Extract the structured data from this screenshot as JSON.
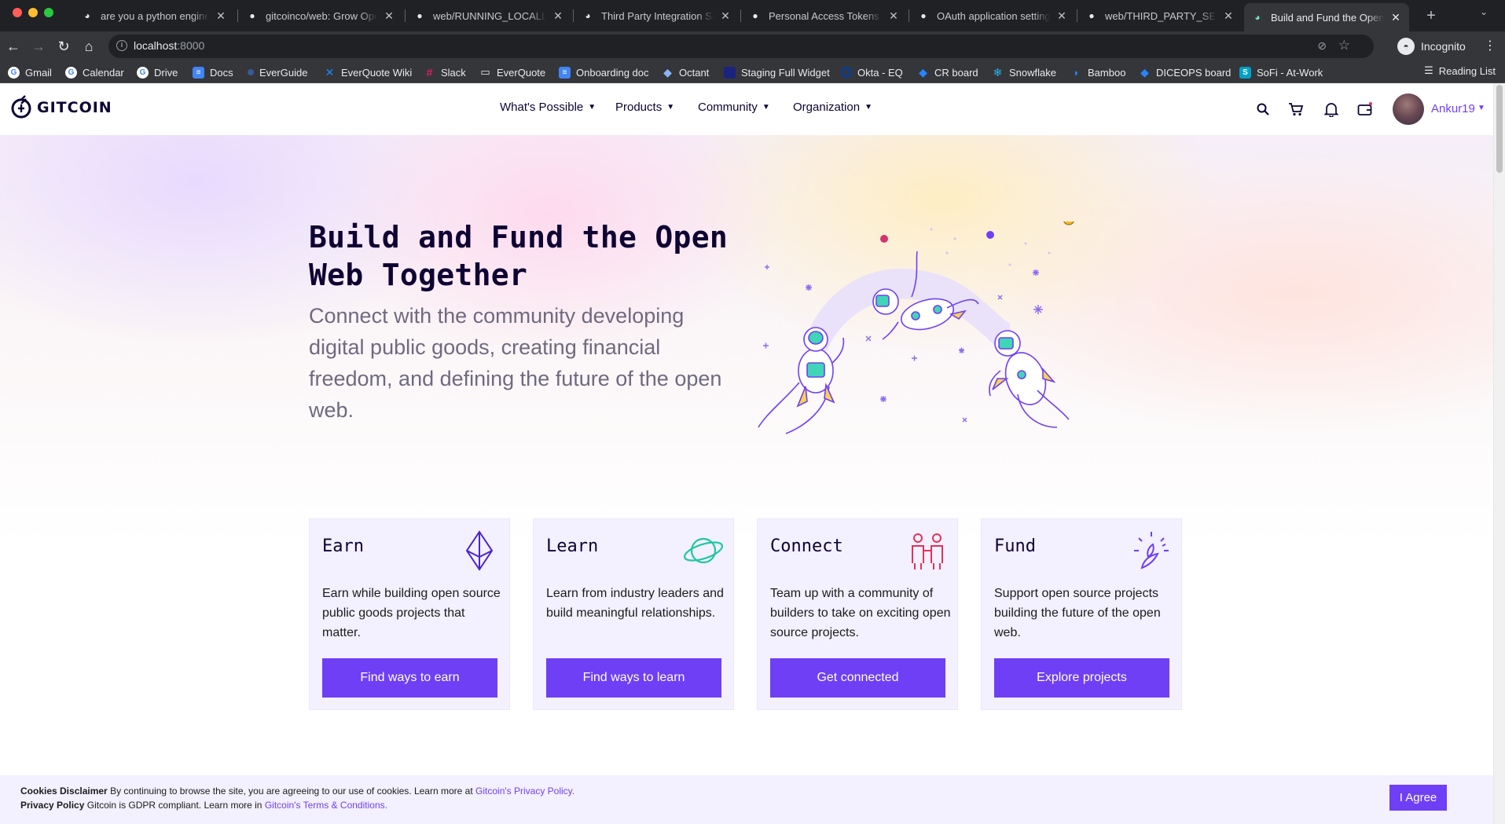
{
  "browser": {
    "tabs": [
      {
        "title": "are you a python engineer",
        "favicon": "gitcoin-icon"
      },
      {
        "title": "gitcoinco/web: Grow Open",
        "favicon": "github-icon"
      },
      {
        "title": "web/RUNNING_LOCALLY_",
        "favicon": "github-icon"
      },
      {
        "title": "Third Party Integration Se",
        "favicon": "gitcoin-icon"
      },
      {
        "title": "Personal Access Tokens",
        "favicon": "github-icon"
      },
      {
        "title": "OAuth application settings",
        "favicon": "github-icon"
      },
      {
        "title": "web/THIRD_PARTY_SETU",
        "favicon": "github-icon"
      },
      {
        "title": "Build and Fund the Open W",
        "favicon": "gitcoin-icon",
        "active": true
      }
    ],
    "url_host": "localhost",
    "url_port": ":8000",
    "profile_label": "Incognito",
    "bookmarks": [
      {
        "label": "Gmail",
        "icon": "google-icon"
      },
      {
        "label": "Calendar",
        "icon": "google-icon"
      },
      {
        "label": "Drive",
        "icon": "google-icon"
      },
      {
        "label": "Docs",
        "icon": "docs-icon"
      },
      {
        "label": "EverGuide",
        "icon": "dot-icon"
      },
      {
        "label": "EverQuote Wiki",
        "icon": "confluence-icon"
      },
      {
        "label": "Slack",
        "icon": "slack-icon"
      },
      {
        "label": "EverQuote",
        "icon": "folder-icon"
      },
      {
        "label": "Onboarding doc",
        "icon": "docs-icon"
      },
      {
        "label": "Octant",
        "icon": "octant-icon"
      },
      {
        "label": "Staging Full Widget",
        "icon": "widget-icon"
      },
      {
        "label": "Okta - EQ",
        "icon": "okta-icon"
      },
      {
        "label": "CR board",
        "icon": "jira-icon"
      },
      {
        "label": "Snowflake",
        "icon": "snowflake-icon"
      },
      {
        "label": "Bamboo",
        "icon": "bamboo-icon"
      },
      {
        "label": "DICEOPS board",
        "icon": "jira-icon"
      },
      {
        "label": "SoFi - At-Work",
        "icon": "sofi-icon"
      }
    ],
    "reading_list": "Reading List"
  },
  "site": {
    "logo_text": "GITCOIN",
    "nav": {
      "items": [
        "What's Possible",
        "Products",
        "Community",
        "Organization"
      ]
    },
    "user": {
      "name": "Ankur19"
    }
  },
  "hero": {
    "title": "Build and Fund the Open Web Together",
    "subtitle": "Connect with the community developing digital public goods, creating financial freedom, and defining the future of the open web."
  },
  "cards": [
    {
      "title": "Earn",
      "icon": "ethereum-diamond-icon",
      "description": "Earn while building open source public goods projects that matter.",
      "button": "Find ways to earn"
    },
    {
      "title": "Learn",
      "icon": "planet-icon",
      "description": "Learn from industry leaders and build meaningful relationships.",
      "button": "Find ways to learn"
    },
    {
      "title": "Connect",
      "icon": "people-icon",
      "description": "Team up with a community of builders to take on exciting open source projects.",
      "button": "Get connected"
    },
    {
      "title": "Fund",
      "icon": "sprout-icon",
      "description": "Support open source projects building the future of the open web.",
      "button": "Explore projects"
    }
  ],
  "cookie": {
    "cookies_label": "Cookies Disclaimer",
    "cookies_text": "By continuing to browse the site, you are agreeing to our use of cookies. Learn more at",
    "cookies_link": "Gitcoin's Privacy Policy.",
    "privacy_label": "Privacy Policy",
    "privacy_text": "Gitcoin is GDPR compliant. Learn more in",
    "privacy_link": "Gitcoin's Terms & Conditions.",
    "agree_button": "I Agree"
  },
  "colors": {
    "brand_purple": "#6f3ff5",
    "ink": "#0e0333",
    "card_bg": "#f3f0ff"
  }
}
